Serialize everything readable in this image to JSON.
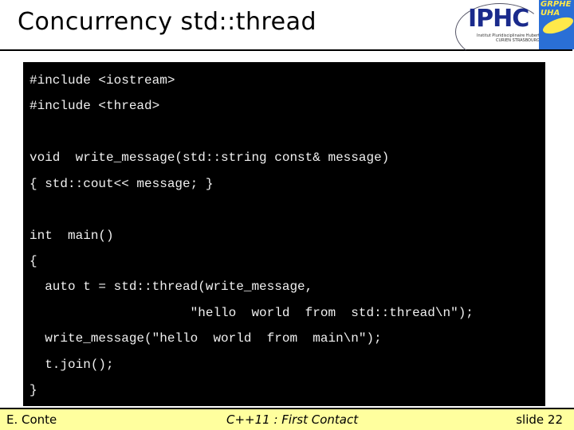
{
  "slide": {
    "title": "Concurrency std::thread",
    "logos": {
      "iphc": {
        "name": "IPHC",
        "subtitle": "Institut Pluridisciplinaire Hubert CURIEN STRASBOURG"
      },
      "grphe": {
        "name": "GRPHE",
        "subtitle": "UHA"
      }
    },
    "code_lines": [
      "#include <iostream>",
      "#include <thread>",
      "void  write_message(std::string const& message)",
      "{ std::cout<< message; }",
      "int  main()",
      "{",
      "  auto t = std::thread(write_message,",
      "                     \"hello  world  from  std::thread\\n\");",
      "  write_message(\"hello  world  from  main\\n\");",
      "  t.join();",
      "}"
    ],
    "footer": {
      "author": "E. Conte",
      "subject": "C++11 : First Contact",
      "slide_number": "slide 22"
    }
  }
}
